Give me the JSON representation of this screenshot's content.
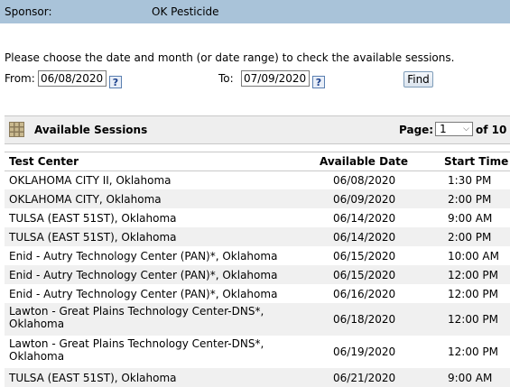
{
  "sponsor": {
    "label": "Sponsor:",
    "value": "OK Pesticide"
  },
  "instructions": "Please choose the date and month (or date range) to check the available sessions.",
  "filter": {
    "from_label": "From:",
    "from_value": "06/08/2020",
    "to_label": "To:",
    "to_value": "07/09/2020",
    "help_glyph": "?",
    "find_label": "Find"
  },
  "sessions": {
    "title": "Available Sessions",
    "page_label": "Page:",
    "page_selected": "1",
    "page_total": "of 10"
  },
  "table": {
    "headers": {
      "center": "Test Center",
      "date": "Available Date",
      "time": "Start Time"
    },
    "rows": [
      {
        "center": "OKLAHOMA CITY II, Oklahoma",
        "date": "06/08/2020",
        "time": "1:30 PM"
      },
      {
        "center": "OKLAHOMA CITY, Oklahoma",
        "date": "06/09/2020",
        "time": "2:00 PM"
      },
      {
        "center": "TULSA (EAST 51ST), Oklahoma",
        "date": "06/14/2020",
        "time": "9:00 AM"
      },
      {
        "center": "TULSA (EAST 51ST), Oklahoma",
        "date": "06/14/2020",
        "time": "2:00 PM"
      },
      {
        "center": "Enid - Autry Technology Center (PAN)*, Oklahoma",
        "date": "06/15/2020",
        "time": "10:00 AM"
      },
      {
        "center": "Enid - Autry Technology Center (PAN)*, Oklahoma",
        "date": "06/15/2020",
        "time": "12:00 PM"
      },
      {
        "center": "Enid - Autry Technology Center (PAN)*, Oklahoma",
        "date": "06/16/2020",
        "time": "12:00 PM"
      },
      {
        "center": "Lawton - Great Plains Technology Center-DNS*, Oklahoma",
        "date": "06/18/2020",
        "time": "12:00 PM"
      },
      {
        "center": "Lawton - Great Plains Technology Center-DNS*, Oklahoma",
        "date": "06/19/2020",
        "time": "12:00 PM"
      },
      {
        "center": "TULSA (EAST 51ST), Oklahoma",
        "date": "06/21/2020",
        "time": "9:00 AM"
      }
    ]
  },
  "colors": {
    "sponsor_bar": "#a9c3d9",
    "row_alt": "#f0f0f0",
    "header_bg": "#eeeeee"
  },
  "icons": {
    "grid": "grid-icon",
    "help": "help-icon",
    "dropdown": "chevron-down-icon"
  }
}
